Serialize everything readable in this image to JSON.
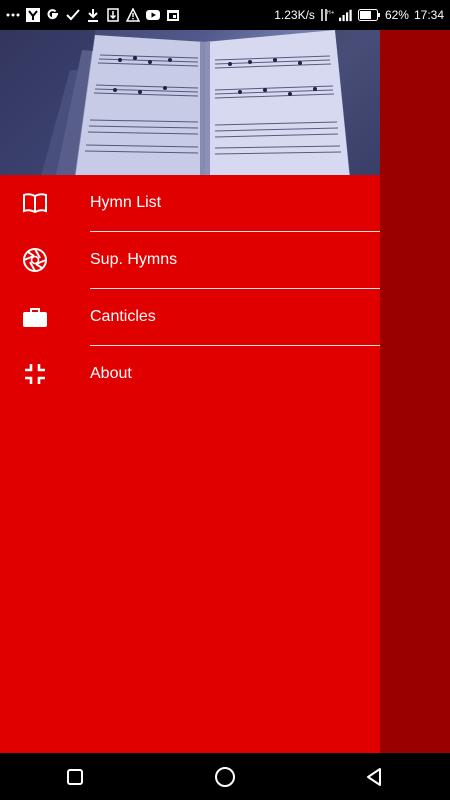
{
  "status_bar": {
    "left_icons": [
      "overflow-dots-icon",
      "yahoo-icon",
      "google-icon",
      "check-icon",
      "download-icon",
      "sd-download-icon",
      "warning-icon",
      "youtube-icon",
      "calendar-icon"
    ],
    "network_speed": "1.23K/s",
    "network_type": "H+",
    "battery": "62%",
    "time": "17:34"
  },
  "drawer": {
    "header_image": "open-hymn-book-image",
    "items": [
      {
        "label": "Hymn List",
        "icon": "book-icon"
      },
      {
        "label": "Sup. Hymns",
        "icon": "aperture-icon"
      },
      {
        "label": "Canticles",
        "icon": "briefcase-icon"
      },
      {
        "label": "About",
        "icon": "fullscreen-exit-icon"
      }
    ]
  },
  "nav_bar": {
    "buttons": [
      "recents-button",
      "home-button",
      "back-button"
    ]
  },
  "colors": {
    "drawer_bg": "#e00000",
    "scrim_bg": "#9b0000",
    "divider": "#ffe0e0"
  }
}
